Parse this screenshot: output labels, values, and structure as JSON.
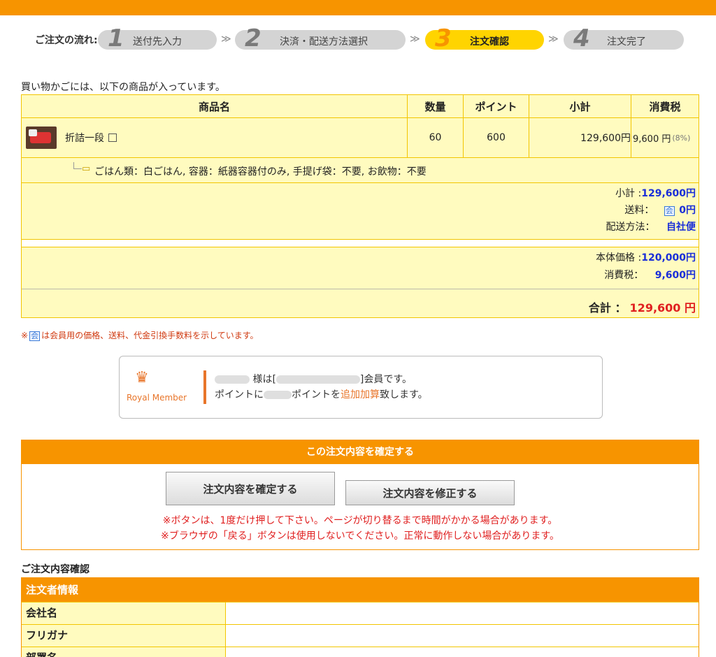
{
  "steps": {
    "label": "ご注文の流れ:",
    "items": [
      {
        "num": "1",
        "label": "送付先入力"
      },
      {
        "num": "2",
        "label": "決済・配送方法選択"
      },
      {
        "num": "3",
        "label": "注文確認"
      },
      {
        "num": "4",
        "label": "注文完了"
      }
    ],
    "arrow": "≫"
  },
  "intro": "買い物かごには、以下の商品が入っています。",
  "cart": {
    "headers": {
      "name": "商品名",
      "qty": "数量",
      "point": "ポイント",
      "subtotal": "小計",
      "tax": "消費税"
    },
    "item": {
      "name": "折詰一段",
      "qty": "60",
      "point": "600",
      "subtotal": "129,600円",
      "tax": "9,600 円",
      "tax_rate": "(8%)"
    },
    "options": "ごはん類：白ごはん, 容器：紙器容器付のみ, 手提げ袋：不要, お飲物：不要",
    "summary": {
      "subtotal_label": "小計 :",
      "subtotal_value": "129,600円",
      "shipping_label": "送料：",
      "shipping_badge": "会",
      "shipping_value": "0円",
      "method_label": "配送方法：",
      "method_value": "自社便"
    },
    "totals": {
      "base_label": "本体価格 :",
      "base_value": "120,000円",
      "tax_label": "消費税：",
      "tax_value": "9,600円",
      "total_label": "合計 ：",
      "total_value": "129,600 円"
    }
  },
  "note": {
    "prefix": "※",
    "badge": "会",
    "text": "は会員用の価格、送料、代金引換手数料を示しています。"
  },
  "member": {
    "badge_text": "Royal Member",
    "line1_a": "様は[",
    "line1_b": "]会員です。",
    "line2_a": "ポイントに",
    "line2_b": "ポイントを",
    "line2_c": "追加加算",
    "line2_d": "致します。"
  },
  "confirm": {
    "title": "この注文内容を確定する",
    "confirm_button": "注文内容を確定する",
    "modify_button": "注文内容を修正する",
    "warn1": "※ボタンは、1度だけ押して下さい。ページが切り替るまで時間がかかる場合があります。",
    "warn2": "※ブラウザの「戻る」ボタンは使用しないでください。正常に動作しない場合があります。"
  },
  "order_info": {
    "section_title": "ご注文内容確認",
    "head": "注文者情報",
    "rows": [
      "会社名",
      "フリガナ",
      "部署名"
    ]
  },
  "colors": {
    "accent": "#f79400",
    "panel": "#fffbbf",
    "border": "#f2c500",
    "blue": "#1a2ed8",
    "red": "#e02020"
  }
}
